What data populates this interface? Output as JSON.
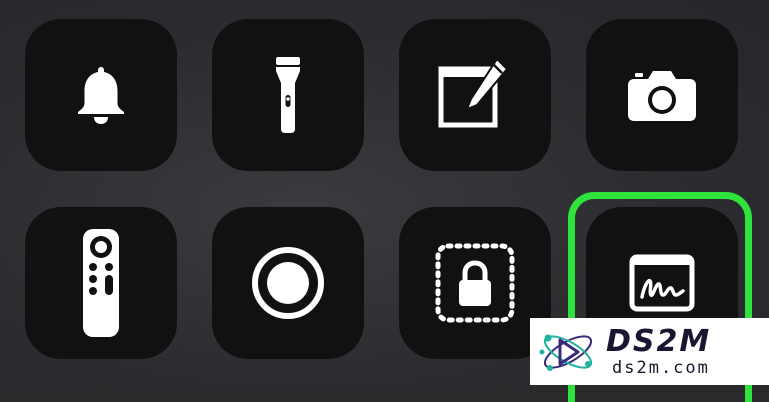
{
  "controls": [
    {
      "id": "alarm",
      "icon": "bell-icon"
    },
    {
      "id": "flashlight",
      "icon": "flashlight-icon"
    },
    {
      "id": "notes",
      "icon": "notes-compose-icon"
    },
    {
      "id": "camera",
      "icon": "camera-icon"
    },
    {
      "id": "apple-tv-remote",
      "icon": "tv-remote-icon"
    },
    {
      "id": "screen-recording",
      "icon": "record-icon"
    },
    {
      "id": "guided-access",
      "icon": "guided-access-lock-icon"
    },
    {
      "id": "markup",
      "icon": "signature-icon",
      "highlighted": true
    }
  ],
  "colors": {
    "tile": "#111112",
    "icon": "#ffffff",
    "highlight": "#30e33c",
    "background": "#2a2b2d"
  },
  "watermark": {
    "title": "DS2M",
    "subtitle": "ds2m.com"
  }
}
